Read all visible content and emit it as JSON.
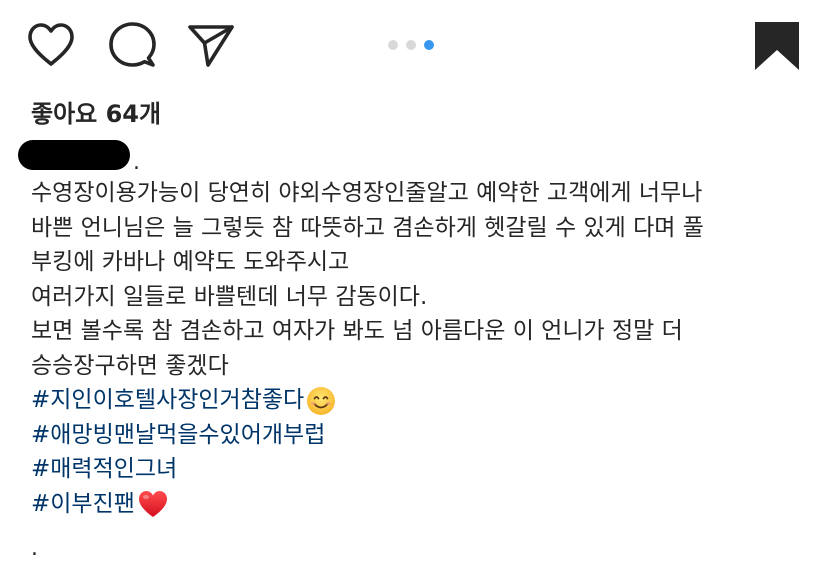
{
  "actions": {
    "like_icon": "heart-outline",
    "comment_icon": "speech-bubble",
    "share_icon": "paper-plane",
    "save_icon": "bookmark-filled"
  },
  "carousel": {
    "count": 3,
    "active_index": 2,
    "inactive_color": "#d9d9d9",
    "active_color": "#3897f0"
  },
  "likes": {
    "text": "좋아요 64개"
  },
  "author": {
    "redacted": true,
    "suffix": "."
  },
  "caption": {
    "lines": [
      "수영장이용가능이 당연히 야외수영장인줄알고 예약한 고객에게 너무나",
      "바쁜 언니님은 늘 그렇듯 참 따뜻하고 겸손하게 헷갈릴 수 있게 다며 풀",
      "부킹에 카바나 예약도 도와주시고",
      "여러가지 일들로 바쁠텐데 너무 감동이다.",
      "보면 볼수록 참 겸손하고 여자가 봐도 넘 아름다운 이 언니가 정말 더",
      "승승장구하면 좋겠다"
    ],
    "hashtags": [
      "#지인이호텔사장인거참좋다",
      "#애망빙맨날먹을수있어개부럽",
      "#매력적인그녀",
      "#이부진팬"
    ],
    "hashtag_emojis": [
      "smiling-face-emoji",
      "",
      "",
      "red-heart-emoji"
    ],
    "trailing": "."
  },
  "colors": {
    "text": "#262626",
    "hashtag": "#003569",
    "accent": "#3897f0"
  }
}
